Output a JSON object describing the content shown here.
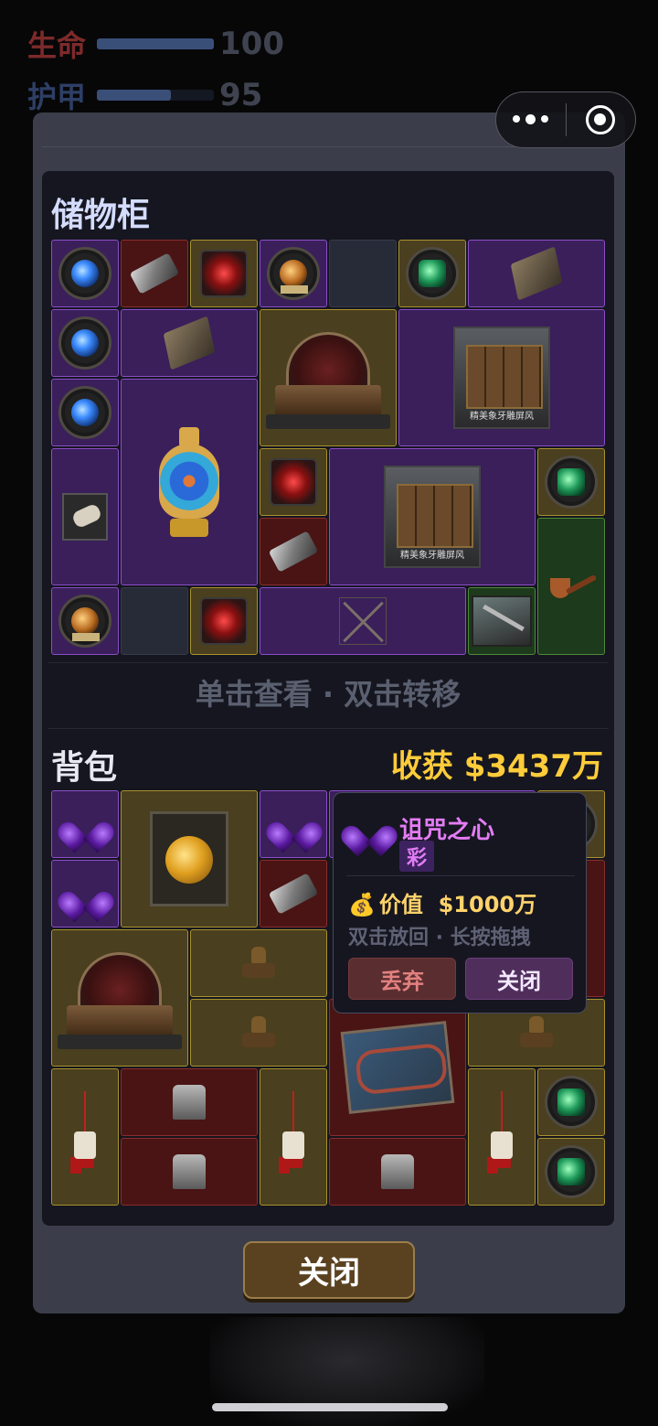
{
  "hud": {
    "hp_label": "生命",
    "hp_value": "100",
    "hp_fraction": 1.0,
    "armor_label": "护甲",
    "armor_value": "95",
    "armor_fraction": 0.63
  },
  "capsule": {
    "menu_icon": "more-dots-icon",
    "close_icon": "target-circle-icon"
  },
  "storage": {
    "title": "储物柜",
    "screen_caption": "精美象牙雕屏风"
  },
  "hint": "单击查看 · 双击转移",
  "backpack": {
    "title": "背包",
    "harvest": "收获 $3437万"
  },
  "tooltip": {
    "name": "诅咒之心",
    "rarity": "彩",
    "value_icon": "money-bag-icon",
    "value_label": "价值",
    "value": "$1000万",
    "hint": "双击放回 · 长按拖拽",
    "discard_label": "丢弃",
    "close_label": "关闭"
  },
  "close_button": "关闭",
  "colors": {
    "rarity_purple": "#8a4ec8",
    "rarity_gold": "#a8922e",
    "rarity_red": "#8a2c2c",
    "rarity_green": "#4f8a3a",
    "harvest_gold": "#ffcc3a",
    "tooltip_name": "#e47cf5"
  }
}
